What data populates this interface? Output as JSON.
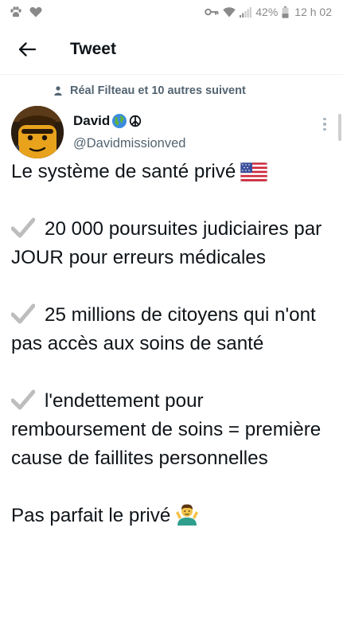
{
  "status_bar": {
    "battery_percent": "42%",
    "time": "12 h 02",
    "battery_level": 0.42
  },
  "header": {
    "title": "Tweet"
  },
  "tweet": {
    "social_context": "Réal Filteau et 10 autres suivent",
    "author_name": "David",
    "handle": "@Davidmissionved",
    "lines": [
      "Le système de santé privé",
      "20 000 poursuites judiciaires par JOUR pour erreurs médicales",
      "25 millions de citoyens qui n'ont pas accès aux soins de santé",
      "l'endettement pour remboursement de soins = première cause de faillites personnelles",
      "Pas parfait le privé"
    ]
  },
  "icons": {
    "status_left": [
      "paw-icon",
      "heart-icon"
    ],
    "status_right": [
      "key-icon",
      "wifi-icon",
      "signal-icon",
      "battery-icon"
    ],
    "name_emojis": [
      "globe-icon",
      "peace-icon"
    ],
    "bullet": "check-mark-icon",
    "flag": "us-flag-icon",
    "shrug": "person-shrugging-icon"
  },
  "colors": {
    "text": "#0f1419",
    "secondary": "#536471",
    "divider": "#eff3f4"
  }
}
